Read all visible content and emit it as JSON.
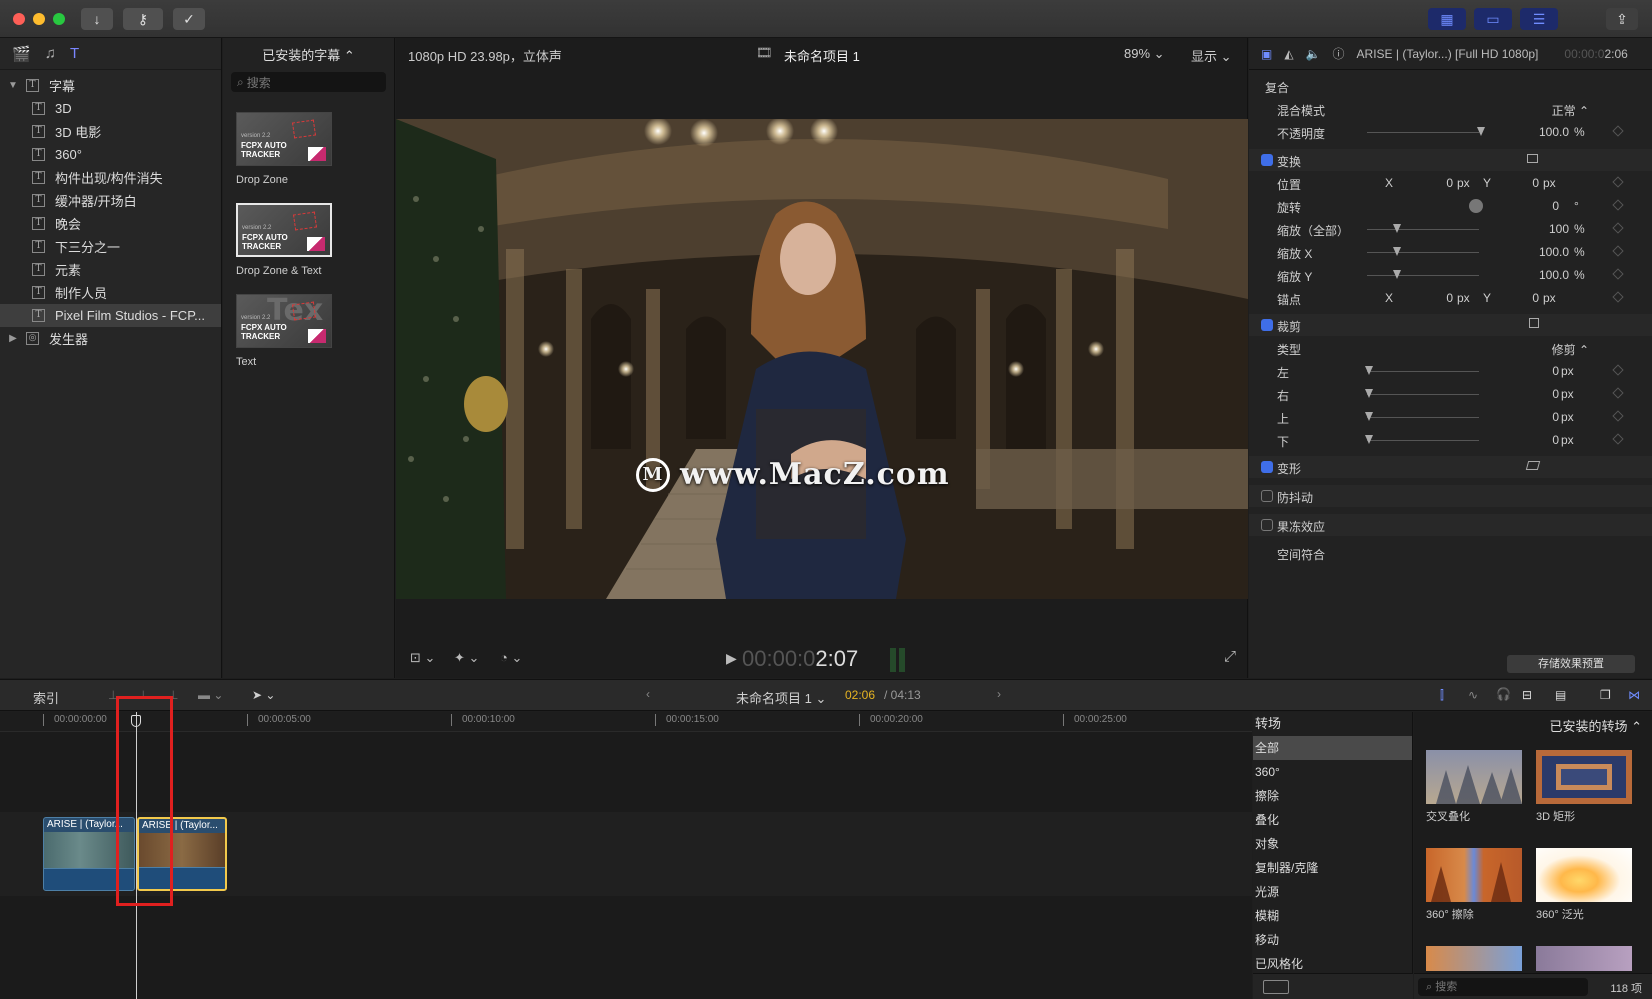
{
  "toolbar": {
    "import_icon": "download-arrow-icon",
    "keyword_icon": "key-icon",
    "background_icon": "checkmark-circle-icon",
    "share_icon": "share-icon"
  },
  "library": {
    "tree": [
      {
        "label": "字幕",
        "expanded": true,
        "level": 0
      },
      {
        "label": "3D",
        "level": 1
      },
      {
        "label": "3D 电影",
        "level": 1
      },
      {
        "label": "360°",
        "level": 1
      },
      {
        "label": "构件出现/构件消失",
        "level": 1
      },
      {
        "label": "缓冲器/开场白",
        "level": 1
      },
      {
        "label": "晚会",
        "level": 1
      },
      {
        "label": "下三分之一",
        "level": 1
      },
      {
        "label": "元素",
        "level": 1
      },
      {
        "label": "制作人员",
        "level": 1
      },
      {
        "label": "Pixel Film Studios - FCP...",
        "level": 1,
        "selected": true
      },
      {
        "label": "发生器",
        "expanded": false,
        "level": 0
      }
    ]
  },
  "titles": {
    "header": "已安装的字幕 ⌃",
    "search_placeholder": "搜索",
    "items": [
      {
        "label": "Drop Zone",
        "version": "version 2.2",
        "name_line1": "FCPX AUTO",
        "name_line2": "TRACKER"
      },
      {
        "label": "Drop Zone & Text",
        "version": "version 2.2",
        "name_line1": "FCPX AUTO",
        "name_line2": "TRACKER",
        "selected": true
      },
      {
        "label": "Text",
        "version": "version 2.2",
        "name_line1": "FCPX AUTO",
        "name_line2": "TRACKER",
        "bg_text": "Tex"
      }
    ]
  },
  "viewer": {
    "format": "1080p HD 23.98p，立体声",
    "project": "未命名项目 1",
    "zoom": "89% ⌄",
    "display": "显示 ⌄",
    "watermark": "www.MacZ.com",
    "timecode_dim": "00:00:0",
    "timecode_bright": "2:07"
  },
  "inspector": {
    "clip_name": "ARISE | (Taylor...) [Full HD 1080p]",
    "duration_dim": "00:00:0",
    "duration": "2:06",
    "composite": {
      "label": "复合",
      "blend_label": "混合模式",
      "blend_value": "正常 ⌃",
      "opacity_label": "不透明度",
      "opacity_value": "100.0",
      "opacity_unit": "%"
    },
    "transform": {
      "label": "变换",
      "position_label": "位置",
      "pos_x": "0",
      "pos_y": "0",
      "rotation_label": "旋转",
      "rotation_value": "0",
      "rotation_unit": "°",
      "scale_all_label": "缩放（全部）",
      "scale_all_value": "100",
      "scale_all_unit": "%",
      "scale_x_label": "缩放 X",
      "scale_x_value": "100.0",
      "scale_y_label": "缩放 Y",
      "scale_y_value": "100.0",
      "anchor_label": "锚点",
      "anchor_x": "0",
      "anchor_y": "0"
    },
    "crop": {
      "label": "裁剪",
      "type_label": "类型",
      "type_value": "修剪 ⌃",
      "left_label": "左",
      "left_value": "0",
      "right_label": "右",
      "right_value": "0",
      "top_label": "上",
      "top_value": "0",
      "bottom_label": "下",
      "bottom_value": "0"
    },
    "distort_label": "变形",
    "stabilize_label": "防抖动",
    "rolling_label": "果冻效应",
    "spatial_label": "空间符合",
    "x_label": "X",
    "y_label": "Y",
    "px": "px",
    "pct": "%",
    "save_preset": "存储效果预置"
  },
  "timeline_bar": {
    "index": "索引",
    "project": "未命名项目 1 ⌄",
    "current": "02:06",
    "total": "/ 04:13"
  },
  "ruler": [
    "00:00:00:00",
    "00:00:05:00",
    "00:00:10:00",
    "00:00:15:00",
    "00:00:20:00",
    "00:00:25:00"
  ],
  "clips": [
    {
      "name": "ARISE | (Taylor..."
    },
    {
      "name": "ARISE | (Taylor..."
    }
  ],
  "transitions": {
    "header": "转场",
    "installed": "已安装的转场 ⌃",
    "categories": [
      "全部",
      "360°",
      "擦除",
      "叠化",
      "对象",
      "复制器/克隆",
      "光源",
      "模糊",
      "移动",
      "已风格化"
    ],
    "items": [
      {
        "label": "交叉叠化"
      },
      {
        "label": "3D 矩形"
      },
      {
        "label": "360° 擦除"
      },
      {
        "label": "360° 泛光"
      }
    ],
    "search_placeholder": "搜索",
    "count": "118 项"
  },
  "colors": {
    "accent": "#3f6ee8",
    "selection_red": "#e0201f",
    "timecode_yellow": "#e6b422"
  }
}
